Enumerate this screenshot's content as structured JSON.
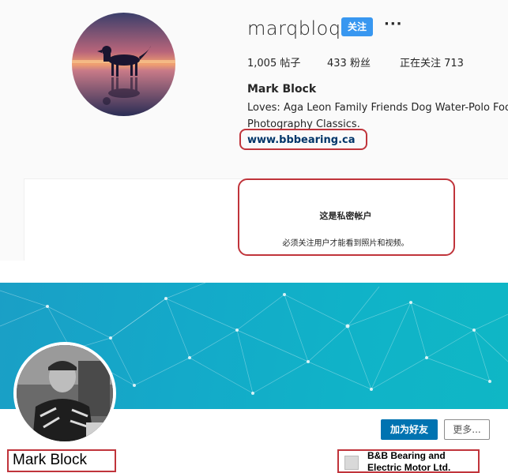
{
  "instagram": {
    "username": "marqbloq",
    "follow_label": "关注",
    "more_label": "···",
    "stats": {
      "posts": "1,005 帖子",
      "followers": "433 粉丝",
      "following": "正在关注 713"
    },
    "full_name": "Mark Block",
    "bio_line1": "Loves: Aga Leon Family Friends Dog Water-Polo Football",
    "bio_line2": "Photography Classics.",
    "website": "www.bbbearing.ca",
    "private_title": "这是私密帐户",
    "private_subtitle": "必须关注用户才能看到照片和视频。",
    "follow_color": "#3897f0"
  },
  "linkedin": {
    "connect_label": "加为好友",
    "more_label": "更多...",
    "name": "Mark Block",
    "company_line1": "B&B Bearing and",
    "company_line2": "Electric Motor Ltd.",
    "connect_color": "#0073b1",
    "banner_color": "#14a9c9"
  },
  "annotation_color": "#c0343b"
}
